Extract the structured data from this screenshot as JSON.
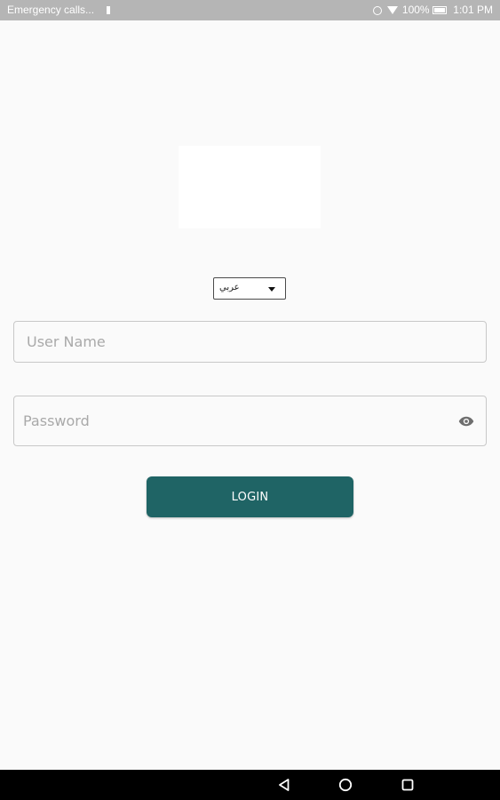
{
  "status_bar": {
    "left_text": "Emergency  calls...",
    "battery_text": "100%",
    "time": "1:01  PM",
    "icons": [
      "sim-icon",
      "alarm-icon",
      "wifi-icon",
      "battery-icon"
    ]
  },
  "language": {
    "selected": "عربي",
    "icon": "dropdown-caret-icon"
  },
  "username": {
    "placeholder": "User Name",
    "value": ""
  },
  "password": {
    "placeholder": "Password",
    "value": "",
    "toggle_icon": "eye-icon"
  },
  "login": {
    "label": "LOGIN"
  },
  "colors": {
    "primary": "#1f6465",
    "background": "#fafafa",
    "status_bar": "#b5b5b5",
    "nav_bar": "#000000"
  },
  "nav_bar": {
    "icons": [
      "back-icon",
      "home-icon",
      "recents-icon"
    ]
  }
}
